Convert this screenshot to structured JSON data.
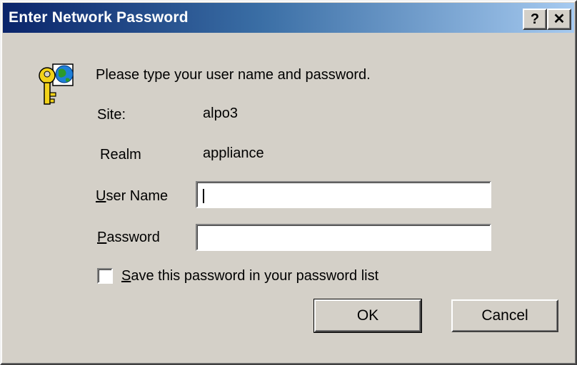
{
  "window": {
    "title": "Enter Network Password",
    "help_label": "?",
    "close_label": "✕"
  },
  "prompt": "Please type your user name and password.",
  "site": {
    "label": "Site:",
    "value": "alpo3"
  },
  "realm": {
    "label": "Realm",
    "value": "appliance"
  },
  "username": {
    "label_accel": "U",
    "label_rest": "ser Name",
    "value": ""
  },
  "password": {
    "label_accel": "P",
    "label_rest": "assword",
    "value": ""
  },
  "save_password": {
    "label_accel": "S",
    "label_rest": "ave this password in your password list",
    "checked": false
  },
  "buttons": {
    "ok": "OK",
    "cancel": "Cancel"
  },
  "icons": {
    "dialog": "key-globe-icon"
  },
  "colors": {
    "titlebar_start": "#0a246a",
    "titlebar_end": "#a6caf0",
    "dialog_bg": "#d4d0c8"
  }
}
